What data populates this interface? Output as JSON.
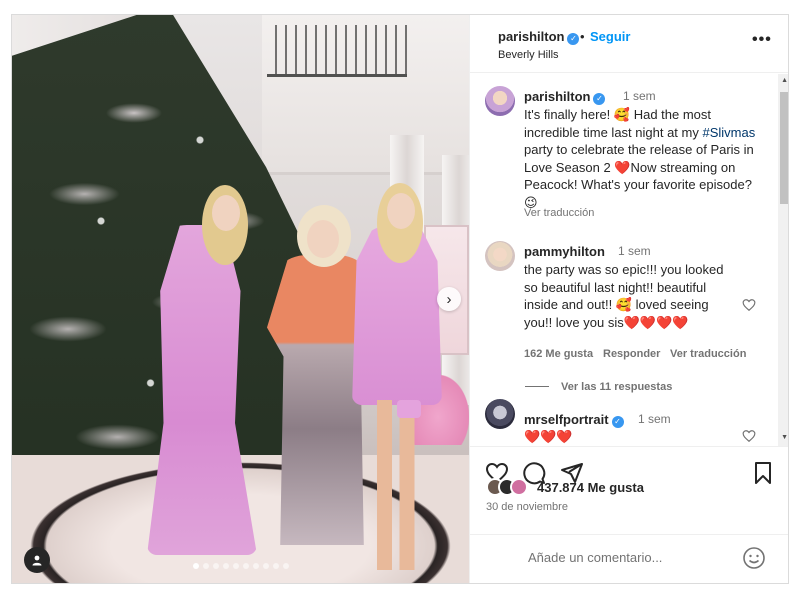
{
  "post": {
    "username": "parishilton",
    "follow_label": "Seguir",
    "location": "Beverly Hills",
    "more_label": "•••"
  },
  "photo": {
    "carousel_dots": 10,
    "active_dot": 0
  },
  "caption": {
    "username": "parishilton",
    "time": "1 sem",
    "text_before_tag": "It's finally here! 🥰 Had the most incredible time last night at my ",
    "tag": "#Slivmas",
    "text_after_tag": " party to celebrate the release of Paris in Love Season 2 ❤️Now streaming on Peacock! What's your favorite episode? 😉",
    "translate_label": "Ver traducción"
  },
  "comments": [
    {
      "username": "pammyhilton",
      "time": "1 sem",
      "text": "the party was so epic!!! you looked so beautiful last night!! beautiful inside and out!! 🥰 loved seeing you!! love you sis❤️❤️❤️❤️",
      "likes": "162 Me gusta",
      "reply_label": "Responder",
      "translate_label": "Ver traducción",
      "view_replies": "Ver las 11 respuestas"
    },
    {
      "username": "mrselfportrait",
      "time": "1 sem",
      "text": "❤️❤️❤️"
    }
  ],
  "actions": {
    "likes_count": "437.874 Me gusta",
    "date": "30 de noviembre",
    "comment_placeholder": "Añade un comentario..."
  },
  "colors": {
    "link_blue": "#0095f6",
    "verified_blue": "#3897f0",
    "muted_text": "#737373"
  },
  "icons": [
    "heart-icon",
    "comment-icon",
    "share-icon",
    "bookmark-icon",
    "more-icon",
    "verified-icon",
    "chevron-right-icon",
    "user-tag-icon",
    "emoji-icon"
  ]
}
